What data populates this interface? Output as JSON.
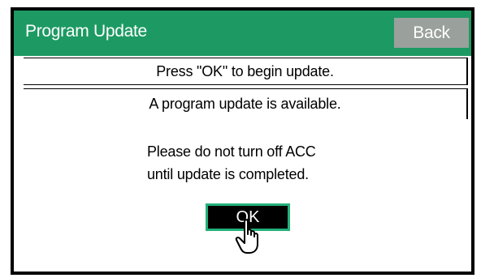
{
  "header": {
    "title": "Program Update",
    "back_label": "Back"
  },
  "rows": {
    "instruction": "Press \"OK\" to begin update.",
    "status": "A program update is available."
  },
  "message": {
    "line1": "Please do not turn off ACC",
    "line2": "until update is completed."
  },
  "ok_label": "OK",
  "colors": {
    "header_bg": "#1d9a63",
    "back_button_bg": "#9aa09c",
    "ok_border": "#24b07a"
  },
  "icons": {
    "pointer": "hand-pointer-icon"
  }
}
